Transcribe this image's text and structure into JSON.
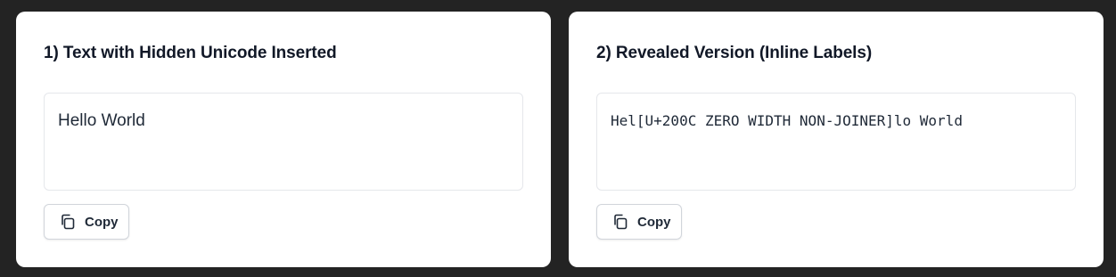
{
  "panels": [
    {
      "title": "1) Text with Hidden Unicode Inserted",
      "text": "Hello World",
      "copy_label": "Copy"
    },
    {
      "title": "2) Revealed Version (Inline Labels)",
      "text": "Hel[U+200C ZERO WIDTH NON-JOINER]lo World",
      "copy_label": "Copy"
    }
  ],
  "icons": {
    "copy": "copy-icon"
  }
}
